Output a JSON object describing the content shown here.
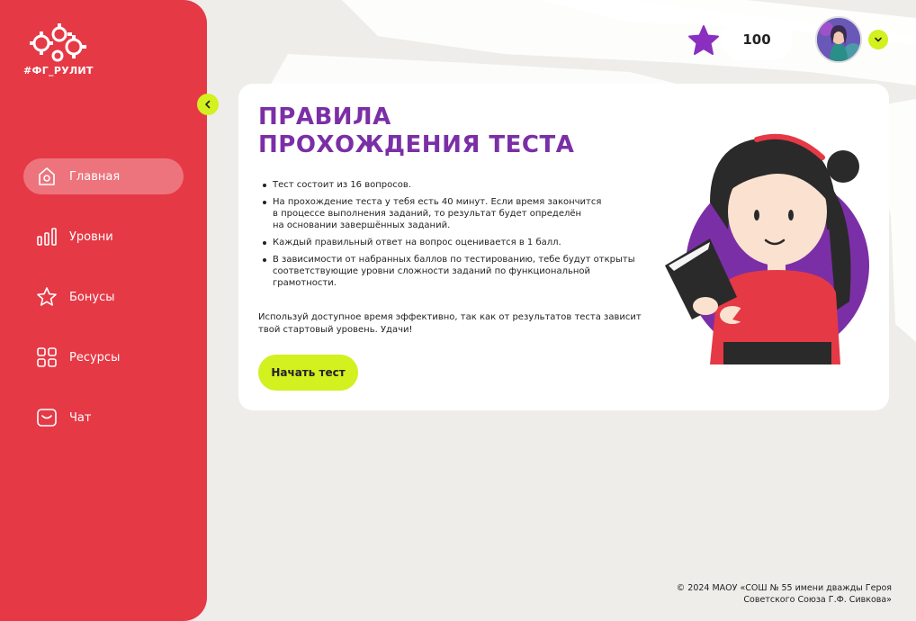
{
  "brand": {
    "logo_text": "#ФГ_РУЛИТ"
  },
  "sidebar": {
    "items": [
      {
        "label": "Главная",
        "icon": "home-icon",
        "active": true
      },
      {
        "label": "Уровни",
        "icon": "bar-chart-icon",
        "active": false
      },
      {
        "label": "Бонусы",
        "icon": "star-icon",
        "active": false
      },
      {
        "label": "Ресурсы",
        "icon": "grid-icon",
        "active": false
      },
      {
        "label": "Чат",
        "icon": "chat-icon",
        "active": false
      }
    ]
  },
  "header": {
    "points": "100",
    "points_icon": "star-icon"
  },
  "card": {
    "title_line1": "ПРАВИЛА",
    "title_line2": "ПРОХОЖДЕНИЯ ТЕСТА",
    "rules": [
      "Тест состоит из 16 вопросов.",
      "На прохождение теста у тебя есть 40 минут. Если время закончится\nв процессе выполнения заданий, то результат будет определён\nна основании завершённых заданий.",
      "Каждый правильный ответ на вопрос оценивается в 1 балл.",
      "В зависимости от набранных баллов по тестированию, тебе будут открыты\nсоответствующие уровни сложности заданий по функциональной\nграмотности."
    ],
    "note": "Используй доступное время эффективно, так как от результатов теста зависит твой стартовый уровень. Удачи!",
    "start_button": "Начать тест"
  },
  "footer": {
    "line1": "© 2024 МАОУ «СОШ № 55 имени дважды Героя",
    "line2": "Советского Союза Г.Ф. Сивкова»"
  },
  "colors": {
    "sidebar": "#e63946",
    "accent": "#d3f01f",
    "title": "#7b2fa6",
    "background": "#efedea"
  }
}
